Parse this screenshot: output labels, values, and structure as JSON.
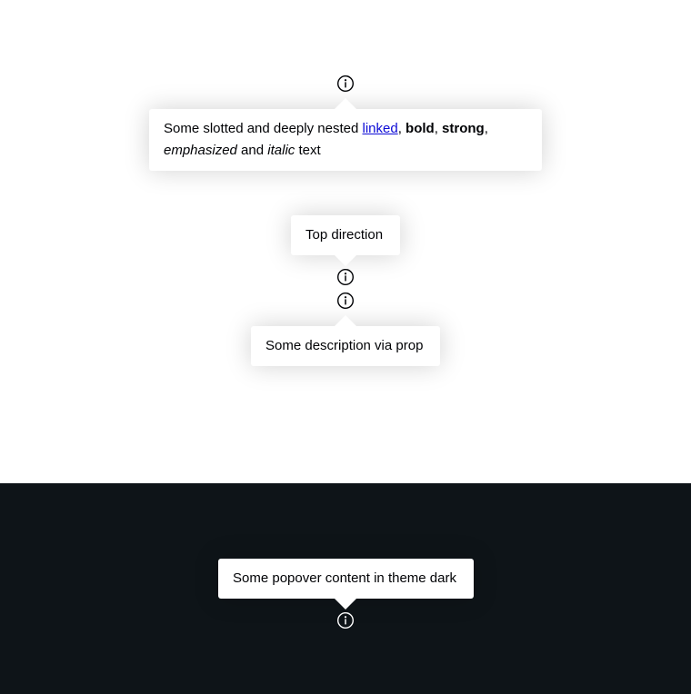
{
  "popovers": {
    "nested": {
      "text_before": "Some slotted and deeply nested ",
      "link": "linked",
      "comma1": ", ",
      "bold": "bold",
      "comma2": ", ",
      "strong": "strong",
      "comma3": ",",
      "emphasized": "emphasized",
      "and": " and ",
      "italic": "italic",
      "text_after": " text"
    },
    "top": {
      "text": "Top direction"
    },
    "prop": {
      "text": "Some description via prop"
    },
    "dark": {
      "text": "Some popover content in theme dark"
    }
  },
  "icons": {
    "trigger": "info-circle-icon"
  },
  "colors": {
    "dark_background": "#0e1418",
    "link": "#0d0bd6",
    "text": "#010205",
    "popover_bg": "#ffffff"
  }
}
